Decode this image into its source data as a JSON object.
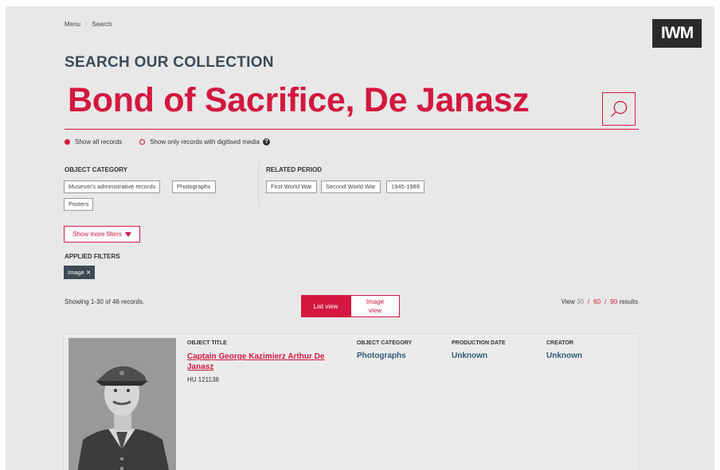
{
  "breadcrumb": [
    "Menu",
    "Search"
  ],
  "logo": {
    "text": "IWM"
  },
  "heading": "SEARCH OUR COLLECTION",
  "search": {
    "query": "Bond of Sacrifice, De Janasz"
  },
  "media_filter": {
    "options": [
      "Show all records",
      "Show only records with digitised media"
    ],
    "selected": "Show all records"
  },
  "facets": {
    "object_category": {
      "title": "OBJECT CATEGORY",
      "options": [
        "Museum's administrative records",
        "Photographs",
        "Posters"
      ]
    },
    "related_period": {
      "title": "RELATED PERIOD",
      "options": [
        "First World War",
        "Second World War",
        "1945-1989"
      ]
    }
  },
  "more_filters_label": "Show more filters",
  "applied_filters": {
    "title": "APPLIED FILTERS",
    "items": [
      {
        "label": "Image",
        "remove": "✕"
      }
    ]
  },
  "results": {
    "showing": "Showing 1-30 of 46 records.",
    "view_toggle": {
      "list": "List view",
      "image": "Image view",
      "active": "list"
    },
    "per_page": {
      "prefix": "View",
      "options": [
        "30",
        "60",
        "90"
      ],
      "current": "30",
      "suffix": "results"
    }
  },
  "result_columns": {
    "title": "OBJECT TITLE",
    "category": "OBJECT CATEGORY",
    "date": "PRODUCTION DATE",
    "creator": "CREATOR"
  },
  "record": {
    "title": "Captain George Kazimierz Arthur De Janasz",
    "id": "HU 121138",
    "category": "Photographs",
    "date": "Unknown",
    "creator": "Unknown"
  },
  "colors": {
    "accent": "#d3173e",
    "heading": "#3d4a56",
    "link": "#2c5c78",
    "background": "#e8e8e8"
  }
}
